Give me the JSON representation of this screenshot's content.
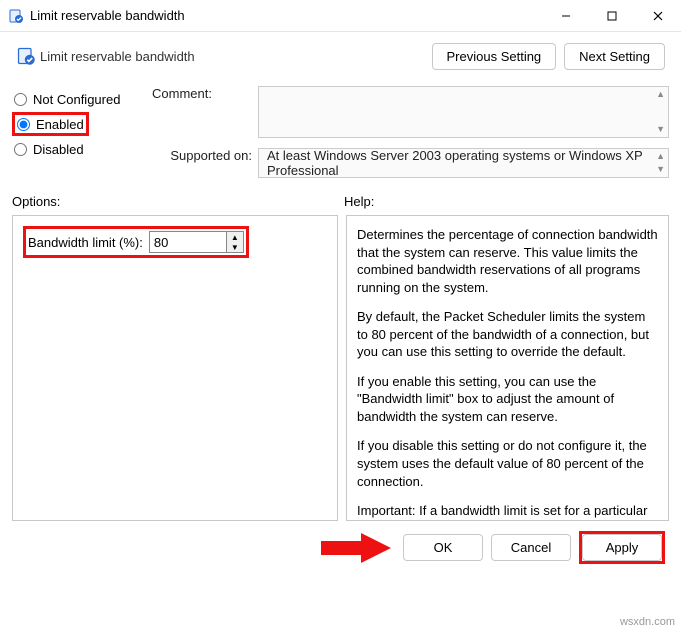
{
  "titlebar": {
    "title": "Limit reservable bandwidth"
  },
  "header": {
    "subtitle": "Limit reservable bandwidth",
    "prev": "Previous Setting",
    "next": "Next Setting"
  },
  "radios": {
    "not_configured": "Not Configured",
    "enabled": "Enabled",
    "disabled": "Disabled",
    "selected": "enabled"
  },
  "labels": {
    "comment": "Comment:",
    "supported": "Supported on:",
    "options": "Options:",
    "help": "Help:"
  },
  "comment_text": "",
  "supported_text": "At least Windows Server 2003 operating systems or Windows XP Professional",
  "option": {
    "label": "Bandwidth limit (%):",
    "value": "80"
  },
  "help": {
    "p1": "Determines the percentage of connection bandwidth that the system can reserve. This value limits the combined bandwidth reservations of all programs running on the system.",
    "p2": "By default, the Packet Scheduler limits the system to 80 percent of the bandwidth of a connection, but you can use this setting to override the default.",
    "p3": "If you enable this setting, you can use the \"Bandwidth limit\" box to adjust the amount of bandwidth the system can reserve.",
    "p4": "If you disable this setting or do not configure it, the system uses the default value of 80 percent of the connection.",
    "p5": "Important: If a bandwidth limit is set for a particular network adapter in the registry, this setting is ignored when configuring that network adapter."
  },
  "footer": {
    "ok": "OK",
    "cancel": "Cancel",
    "apply": "Apply"
  },
  "watermark": "wsxdn.com"
}
